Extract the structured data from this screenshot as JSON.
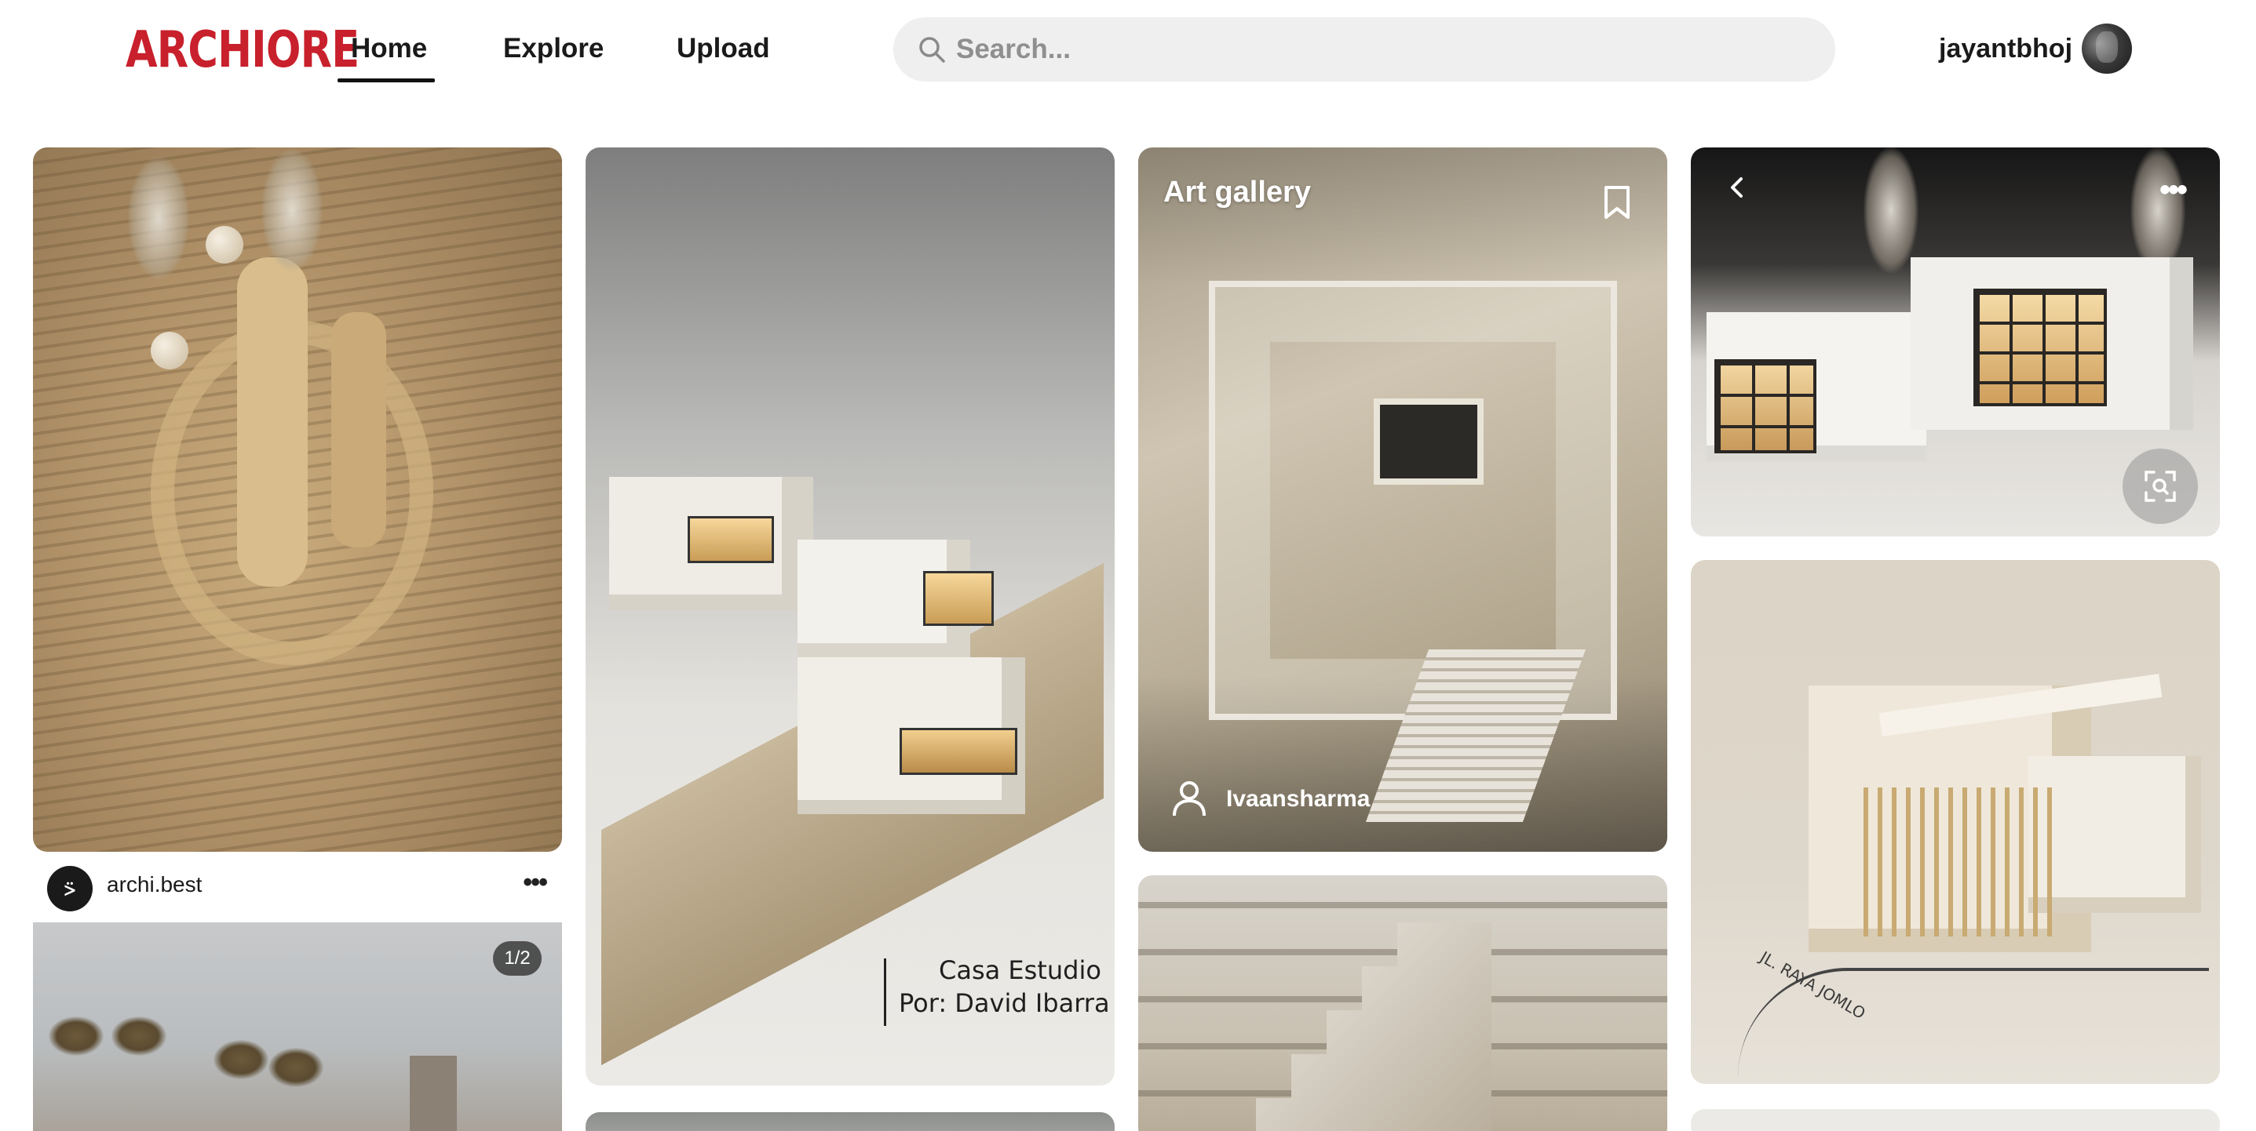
{
  "header": {
    "logo_text": "ARCHIORE",
    "nav": [
      {
        "label": "Home",
        "active": true
      },
      {
        "label": "Explore",
        "active": false
      },
      {
        "label": "Upload",
        "active": false
      }
    ],
    "search": {
      "placeholder": "Search...",
      "value": ""
    },
    "username": "jayantbhoj"
  },
  "feed": {
    "card_gallery": {
      "title": "Art gallery",
      "author": "Ivaansharma"
    },
    "card_post": {
      "account": "archi.best",
      "counter": "1/2"
    },
    "card_casa": {
      "caption_line1": "Casa Estudio",
      "caption_line2": "Por: David Ibarra"
    },
    "card_road": {
      "road_text": "JL. RAYA JOMLO"
    }
  },
  "colors": {
    "brand": "#c8202c",
    "text": "#1a1a1a",
    "search_bg": "#efefef"
  },
  "icons": [
    "search-icon",
    "avatar",
    "bookmark-icon",
    "user-icon",
    "more-icon",
    "back-arrow-icon",
    "visual-search-icon"
  ]
}
